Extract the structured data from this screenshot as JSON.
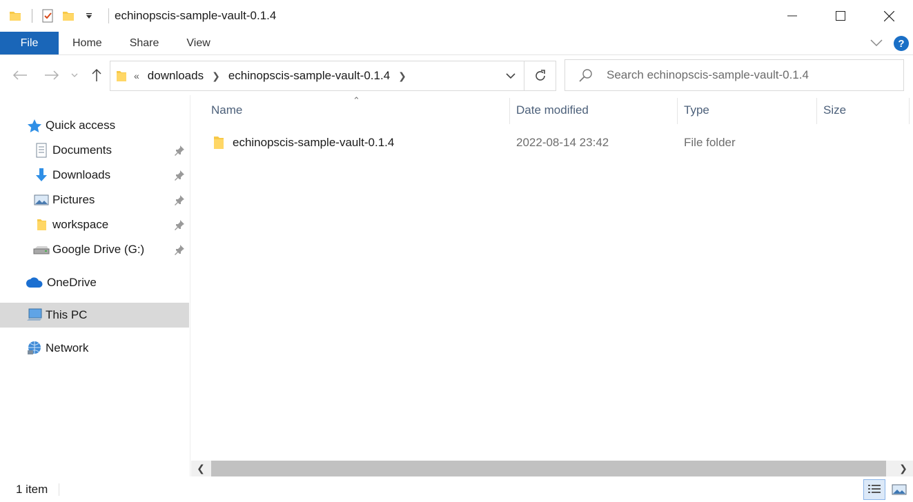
{
  "window": {
    "title": "echinopscis-sample-vault-0.1.4"
  },
  "ribbon": {
    "tabs": [
      "File",
      "Home",
      "Share",
      "View"
    ]
  },
  "address": {
    "overflow": "«",
    "crumbs": [
      "downloads",
      "echinopscis-sample-vault-0.1.4"
    ]
  },
  "search": {
    "placeholder": "Search echinopscis-sample-vault-0.1.4"
  },
  "sidebar": {
    "quick_access": "Quick access",
    "items": [
      {
        "label": "Documents",
        "icon": "documents-icon",
        "pinned": true
      },
      {
        "label": "Downloads",
        "icon": "downloads-icon",
        "pinned": true
      },
      {
        "label": "Pictures",
        "icon": "pictures-icon",
        "pinned": true
      },
      {
        "label": "workspace",
        "icon": "folder-icon",
        "pinned": true
      },
      {
        "label": "Google Drive (G:)",
        "icon": "drive-icon",
        "pinned": true
      }
    ],
    "onedrive": "OneDrive",
    "this_pc": "This PC",
    "network": "Network"
  },
  "columns": {
    "name": "Name",
    "date": "Date modified",
    "type": "Type",
    "size": "Size"
  },
  "files": [
    {
      "name": "echinopscis-sample-vault-0.1.4",
      "date": "2022-08-14 23:42",
      "type": "File folder",
      "size": ""
    }
  ],
  "status": {
    "count": "1 item"
  },
  "colors": {
    "accent": "#1a66b8",
    "folder": "#f7c948",
    "selected": "#d9d9d9"
  }
}
